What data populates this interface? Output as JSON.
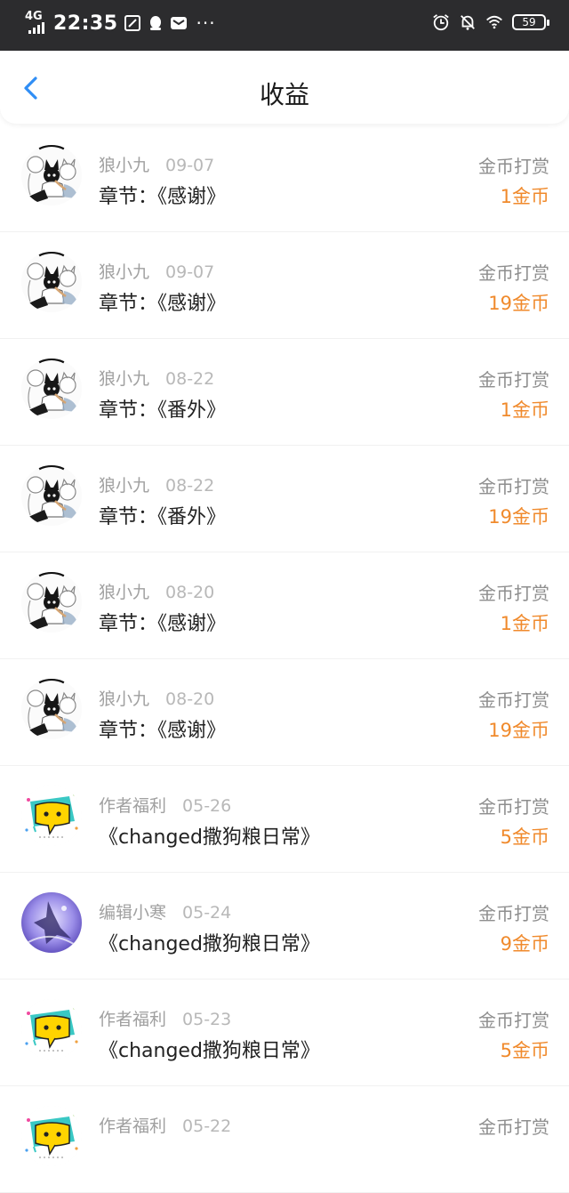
{
  "status_bar": {
    "network": "4G",
    "time": "22:35",
    "battery": "59",
    "icons": [
      "signal-icon",
      "screenshot-icon",
      "qq-icon",
      "mail-icon",
      "more-dots-icon",
      "alarm-icon",
      "mute-icon",
      "wifi-icon",
      "battery-icon"
    ]
  },
  "header": {
    "title": "收益",
    "back_icon": "chevron-left-icon"
  },
  "colors": {
    "accent": "#2f8ef5",
    "amount": "#f08a2c",
    "status_bar_bg": "#2c2c2e"
  },
  "entries": [
    {
      "name": "狼小九",
      "date": "09-07",
      "chapter": "章节：《感谢》",
      "type": "金币打赏",
      "amount": "1金币",
      "avatar": "manga-avatar-icon"
    },
    {
      "name": "狼小九",
      "date": "09-07",
      "chapter": "章节：《感谢》",
      "type": "金币打赏",
      "amount": "19金币",
      "avatar": "manga-avatar-icon"
    },
    {
      "name": "狼小九",
      "date": "08-22",
      "chapter": "章节：《番外》",
      "type": "金币打赏",
      "amount": "1金币",
      "avatar": "manga-avatar-icon"
    },
    {
      "name": "狼小九",
      "date": "08-22",
      "chapter": "章节：《番外》",
      "type": "金币打赏",
      "amount": "19金币",
      "avatar": "manga-avatar-icon"
    },
    {
      "name": "狼小九",
      "date": "08-20",
      "chapter": "章节：《感谢》",
      "type": "金币打赏",
      "amount": "1金币",
      "avatar": "manga-avatar-icon"
    },
    {
      "name": "狼小九",
      "date": "08-20",
      "chapter": "章节：《感谢》",
      "type": "金币打赏",
      "amount": "19金币",
      "avatar": "manga-avatar-icon"
    },
    {
      "name": "作者福利",
      "date": "05-26",
      "chapter": "《changed撒狗粮日常》",
      "type": "金币打赏",
      "amount": "5金币",
      "avatar": "chat-bubble-avatar-icon"
    },
    {
      "name": "编辑小寒",
      "date": "05-24",
      "chapter": "《changed撒狗粮日常》",
      "type": "金币打赏",
      "amount": "9金币",
      "avatar": "purple-art-avatar-icon"
    },
    {
      "name": "作者福利",
      "date": "05-23",
      "chapter": "《changed撒狗粮日常》",
      "type": "金币打赏",
      "amount": "5金币",
      "avatar": "chat-bubble-avatar-icon"
    },
    {
      "name": "作者福利",
      "date": "05-22",
      "chapter": "",
      "type": "金币打赏",
      "amount": "",
      "avatar": "chat-bubble-avatar-icon"
    }
  ]
}
